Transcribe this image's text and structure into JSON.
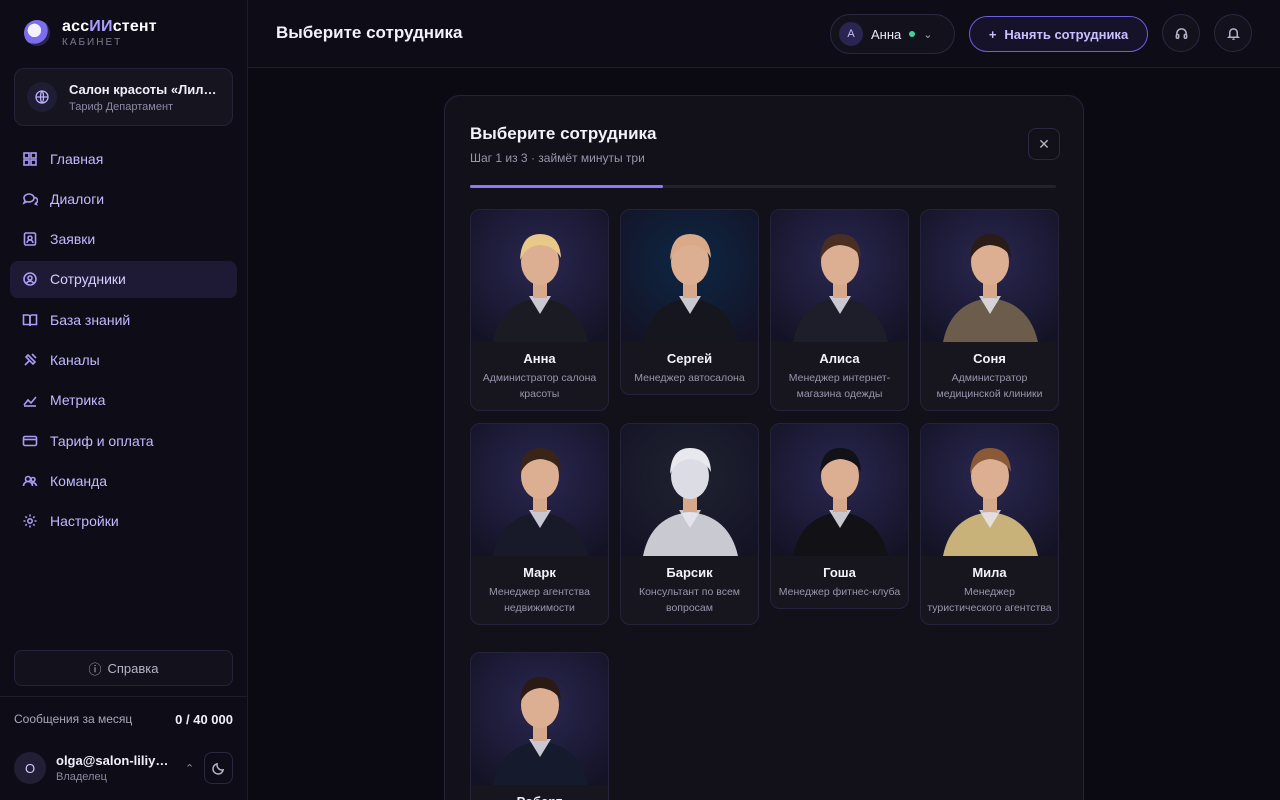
{
  "brand": {
    "name_prefix": "асс",
    "name_accent": "ИИ",
    "name_suffix": "стент",
    "subtitle": "КАБИНЕТ"
  },
  "workspace": {
    "name": "Салон красоты «Лилия»",
    "plan": "Тариф Департамент"
  },
  "nav": [
    {
      "label": "Главная",
      "icon": "grid-icon"
    },
    {
      "label": "Диалоги",
      "icon": "chat-icon"
    },
    {
      "label": "Заявки",
      "icon": "request-icon"
    },
    {
      "label": "Сотрудники",
      "icon": "user-circle-icon",
      "active": true
    },
    {
      "label": "База знаний",
      "icon": "book-icon"
    },
    {
      "label": "Каналы",
      "icon": "satellite-icon"
    },
    {
      "label": "Метрика",
      "icon": "chart-icon"
    },
    {
      "label": "Тариф и оплата",
      "icon": "card-icon"
    },
    {
      "label": "Команда",
      "icon": "team-icon"
    },
    {
      "label": "Настройки",
      "icon": "gear-icon"
    }
  ],
  "help": {
    "label": "Справка"
  },
  "usage": {
    "label": "Сообщения за месяц",
    "value": "0 / 40 000"
  },
  "user": {
    "initial": "O",
    "email": "olga@salon-liliya.ru",
    "role": "Владелец"
  },
  "header": {
    "title": "Выберите сотрудника",
    "agent": {
      "initial": "А",
      "name": "Анна"
    },
    "hire_label": "Нанять сотрудника"
  },
  "modal": {
    "title": "Выберите сотрудника",
    "subtitle": "Шаг 1 из 3 · займёт минуты три",
    "progress": 0.33,
    "employees": [
      {
        "name": "Анна",
        "role": "Администратор салона красоты",
        "palette": [
          "#2a2750",
          "#e9c98a",
          "#1b1b24"
        ]
      },
      {
        "name": "Сергей",
        "role": "Менеджер автосалона",
        "palette": [
          "#0d2744",
          "#d9a98a",
          "#16161e"
        ]
      },
      {
        "name": "Алиса",
        "role": "Менеджер интернет-магазина одежды",
        "palette": [
          "#2a2750",
          "#4a2e22",
          "#1e1d2a"
        ]
      },
      {
        "name": "Соня",
        "role": "Администратор медицинской клиники",
        "palette": [
          "#2a2750",
          "#2a1c16",
          "#6b5c4c"
        ]
      },
      {
        "name": "Марк",
        "role": "Менеджер агентства недвижимости",
        "palette": [
          "#2a2750",
          "#3a2417",
          "#181a2a"
        ]
      },
      {
        "name": "Барсик",
        "role": "Консультант по всем вопросам",
        "palette": [
          "#1f2230",
          "#e8e8ee",
          "#c9c9d2"
        ]
      },
      {
        "name": "Гоша",
        "role": "Менеджер фитнес-клуба",
        "palette": [
          "#2a2750",
          "#111116",
          "#111116"
        ]
      },
      {
        "name": "Мила",
        "role": "Менеджер туристического агентства",
        "palette": [
          "#2a2750",
          "#8a5a38",
          "#c9b27a"
        ]
      },
      {
        "name": "Роберт",
        "role": "",
        "palette": [
          "#2a2750",
          "#2b1a14",
          "#151a2c"
        ]
      }
    ]
  }
}
